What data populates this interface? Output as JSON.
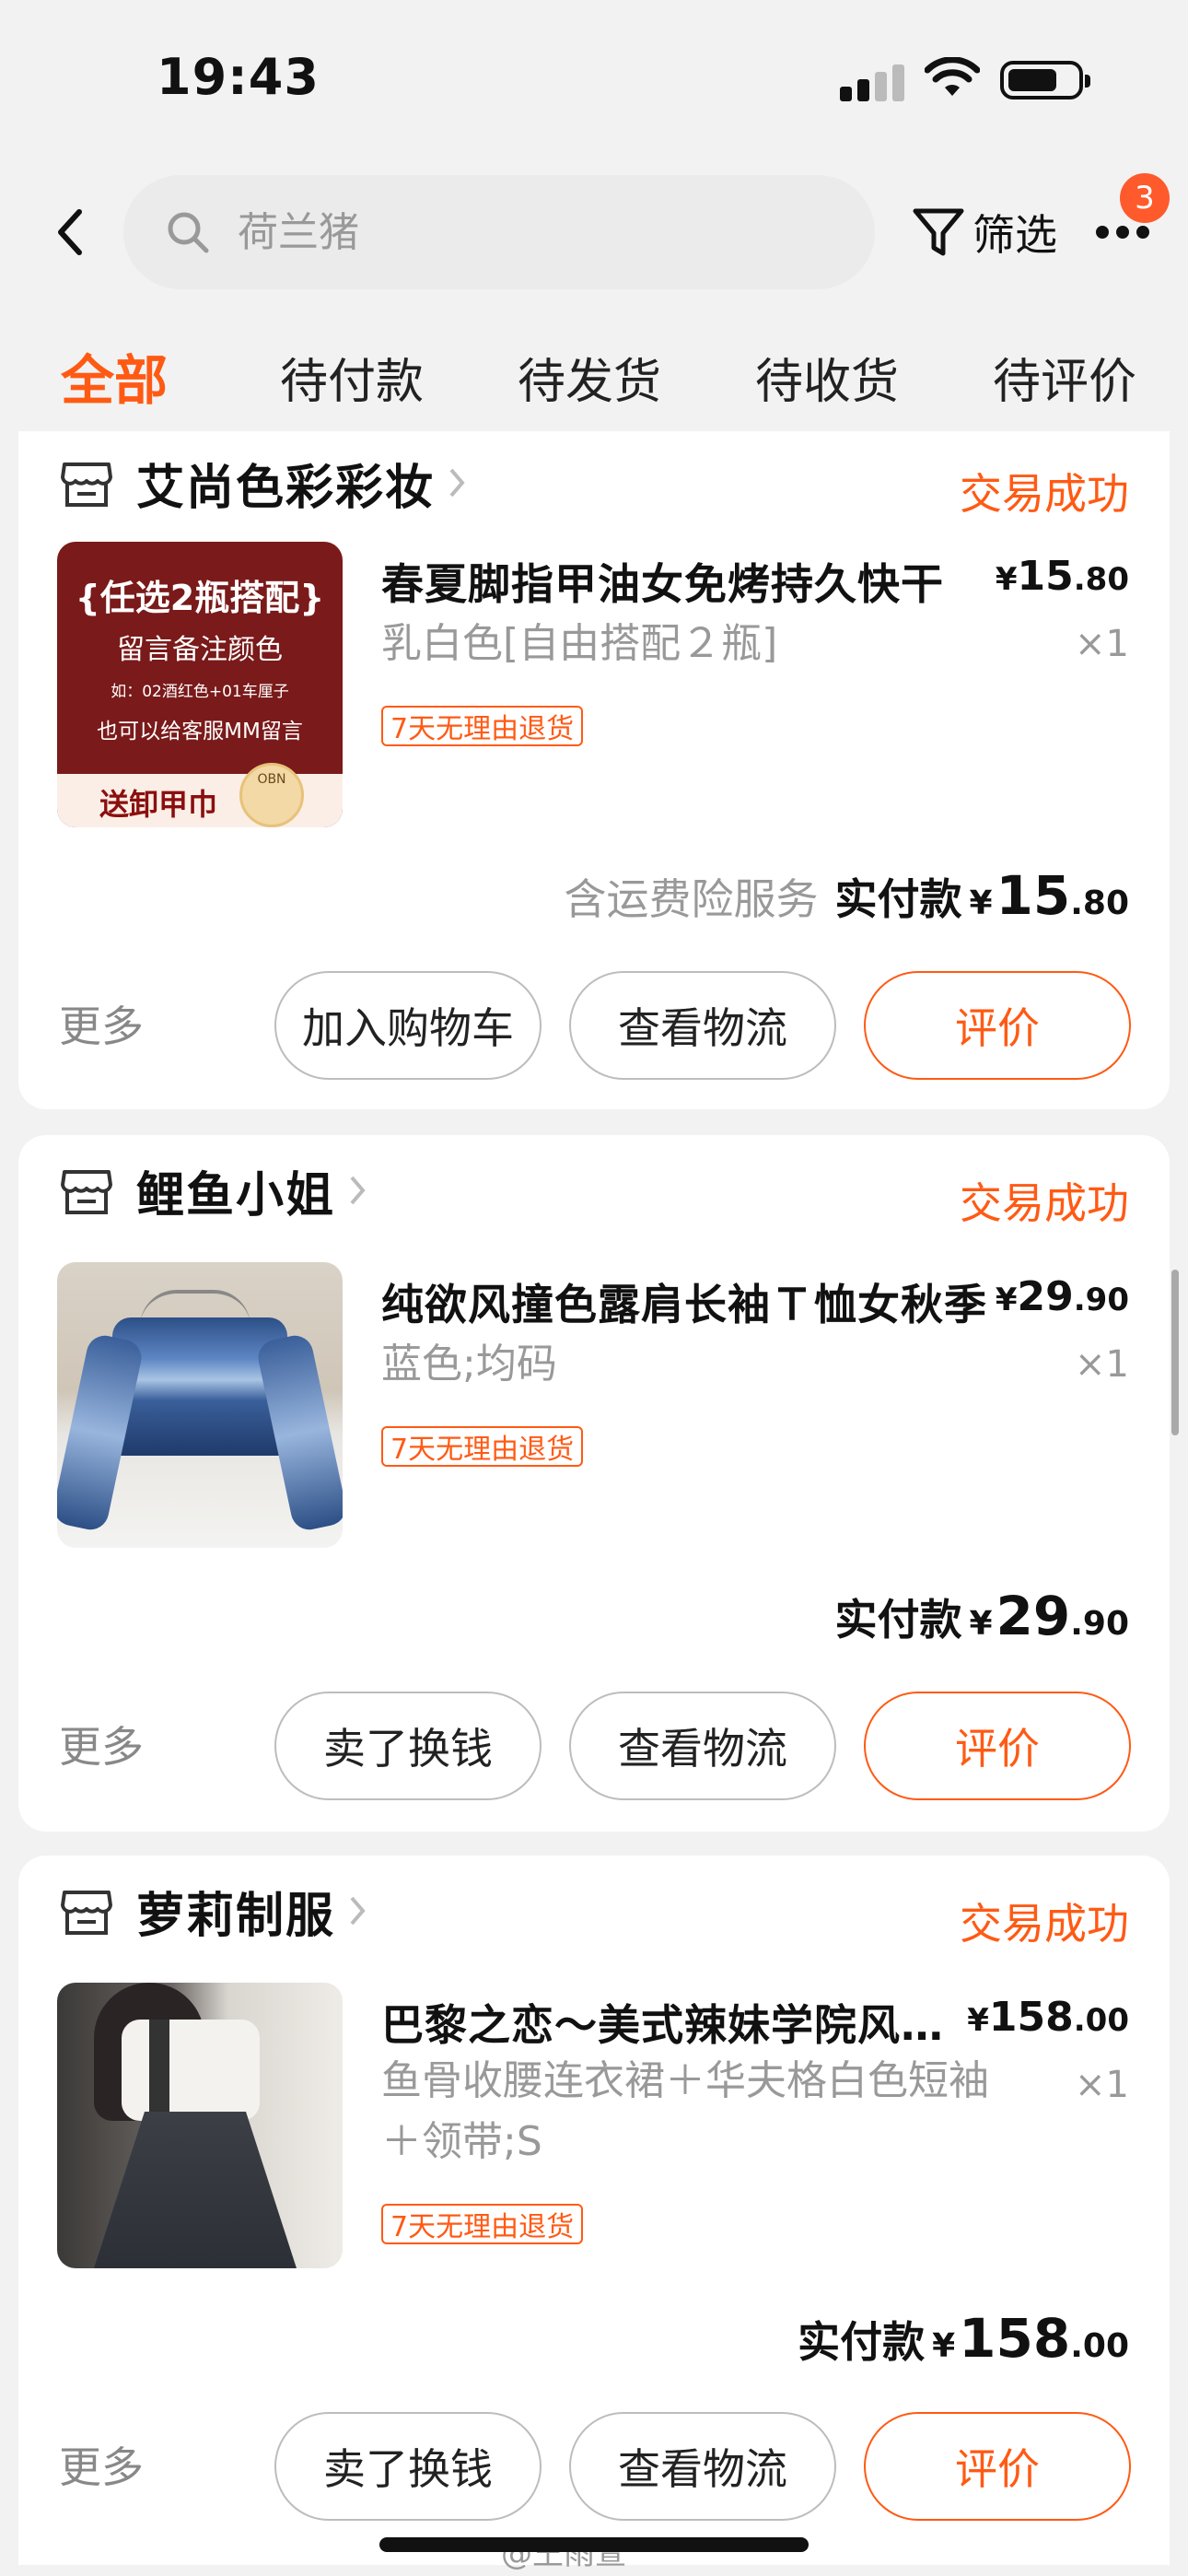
{
  "status_bar": {
    "time": "19:43"
  },
  "header": {
    "search_placeholder": "荷兰猪",
    "filter_label": "筛选",
    "notification_count": "3"
  },
  "tabs": [
    "全部",
    "待付款",
    "待发货",
    "待收货",
    "待评价"
  ],
  "orders": [
    {
      "shop": "艾尚色彩彩妆",
      "status": "交易成功",
      "title": "春夏脚指甲油女免烤持久快干",
      "price_currency": "¥",
      "price_int": "15",
      "price_dec": ".80",
      "sku": "乳白色[自由搭配２瓶]",
      "qty": "×1",
      "tag": "7天无理由退货",
      "insurance": "含运费险服务",
      "total_label": "实付款",
      "total_currency": "¥",
      "total_int": "15",
      "total_dec": ".80",
      "more": "更多",
      "btn1": "加入购物车",
      "btn2": "查看物流",
      "btn3": "评价",
      "thumb_text": {
        "line1": "{任选2瓶搭配}",
        "line2": "留言备注颜色",
        "line3": "如：02酒红色+01车厘子",
        "line4": "也可以给客服MM留言",
        "line5": "送卸甲巾",
        "logo": "OBN"
      }
    },
    {
      "shop": "鲤鱼小姐",
      "status": "交易成功",
      "title": "纯欲风撞色露肩长袖Ｔ恤女秋季",
      "price_currency": "¥",
      "price_int": "29",
      "price_dec": ".90",
      "sku": "蓝色;均码",
      "qty": "×1",
      "tag": "7天无理由退货",
      "total_label": "实付款",
      "total_currency": "¥",
      "total_int": "29",
      "total_dec": ".90",
      "more": "更多",
      "btn1": "卖了换钱",
      "btn2": "查看物流",
      "btn3": "评价"
    },
    {
      "shop": "萝莉制服",
      "status": "交易成功",
      "title": "巴黎之恋～美式辣妹学院风套装",
      "price_currency": "¥",
      "price_int": "158",
      "price_dec": ".00",
      "sku": "鱼骨收腰连衣裙＋华夫格白色短袖＋领带;S",
      "qty": "×1",
      "tag": "7天无理由退货",
      "total_label": "实付款",
      "total_currency": "¥",
      "total_int": "158",
      "total_dec": ".00",
      "more": "更多",
      "btn1": "卖了换钱",
      "btn2": "查看物流",
      "btn3": "评价"
    }
  ],
  "watermark": "@王雨萱",
  "colors": {
    "accent": "#ff5a14",
    "badge": "#ff5a2c",
    "background": "#f2f2f2"
  }
}
